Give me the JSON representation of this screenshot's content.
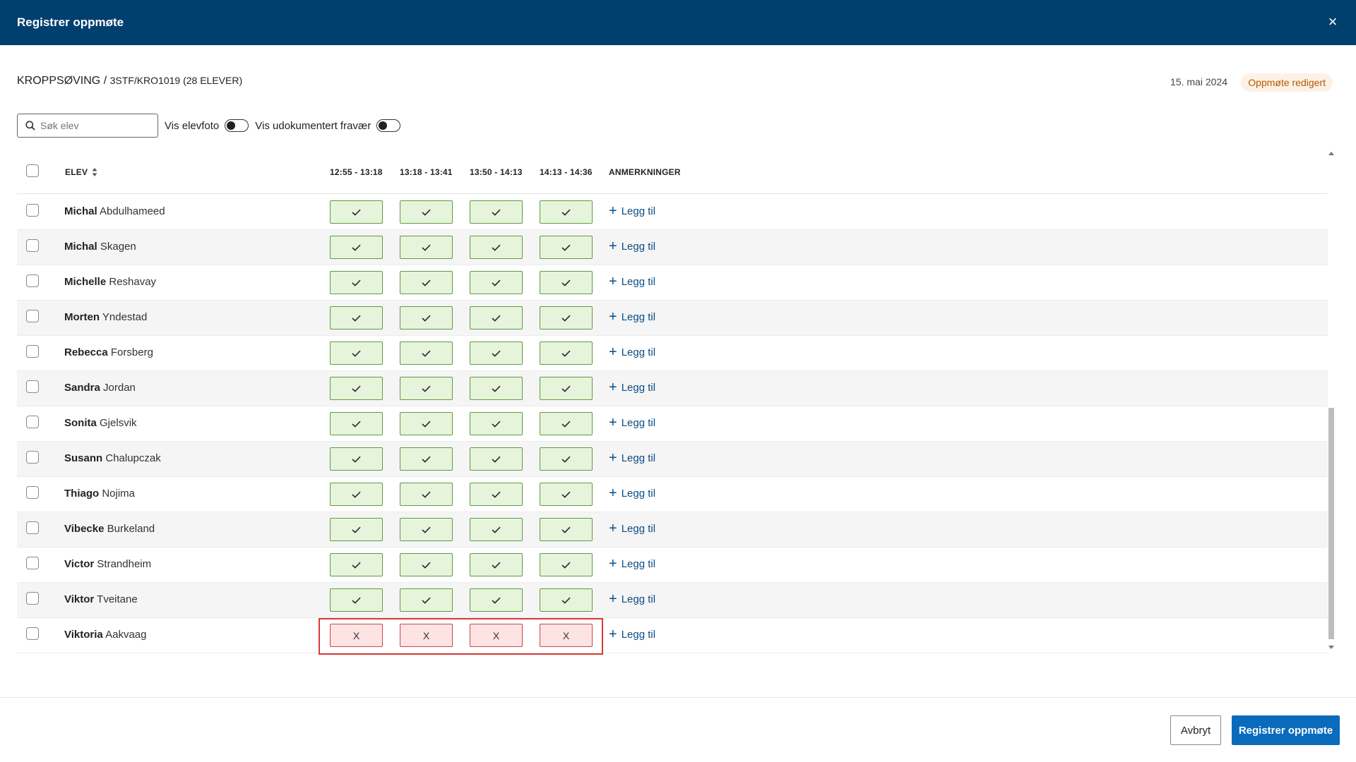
{
  "header": {
    "title": "Registrer oppmøte",
    "close_icon": "×"
  },
  "course": {
    "name": "KROPPSØVING",
    "separator": " / ",
    "group": "3STF/KRO1019 (28 ELEVER)"
  },
  "date": "15. mai 2024",
  "status_badge": "Oppmøte redigert",
  "search": {
    "placeholder": "Søk elev",
    "value": ""
  },
  "toggles": {
    "photo_label": "Vis elevfoto",
    "photo_on": false,
    "undocumented_label": "Vis udokumentert fravær",
    "undocumented_on": false
  },
  "table": {
    "col_student": "ELEV",
    "periods": [
      "12:55 - 13:18",
      "13:18 - 13:41",
      "13:50 - 14:13",
      "14:13 - 14:36"
    ],
    "col_remarks": "ANMERKNINGER",
    "remark_action": "Legg til",
    "absent_mark": "X",
    "rows": [
      {
        "first": "Michal",
        "last": "Abdulhameed",
        "status": "present"
      },
      {
        "first": "Michal",
        "last": "Skagen",
        "status": "present"
      },
      {
        "first": "Michelle",
        "last": "Reshavay",
        "status": "present"
      },
      {
        "first": "Morten",
        "last": "Yndestad",
        "status": "present"
      },
      {
        "first": "Rebecca",
        "last": "Forsberg",
        "status": "present"
      },
      {
        "first": "Sandra",
        "last": "Jordan",
        "status": "present"
      },
      {
        "first": "Sonita",
        "last": "Gjelsvik",
        "status": "present"
      },
      {
        "first": "Susann",
        "last": "Chalupczak",
        "status": "present"
      },
      {
        "first": "Thiago",
        "last": "Nojima",
        "status": "present"
      },
      {
        "first": "Vibecke",
        "last": "Burkeland",
        "status": "present"
      },
      {
        "first": "Victor",
        "last": "Strandheim",
        "status": "present"
      },
      {
        "first": "Viktor",
        "last": "Tveitane",
        "status": "present"
      },
      {
        "first": "Viktoria",
        "last": "Aakvaag",
        "status": "absent"
      }
    ]
  },
  "footer": {
    "cancel_label": "Avbryt",
    "submit_label": "Registrer oppmøte"
  },
  "colors": {
    "header": "#003f6e",
    "present_bg": "#e7f4dc",
    "present_border": "#5f9b3e",
    "absent_bg": "#fde3e3",
    "absent_border": "#c94646",
    "primary": "#0a6bbd",
    "highlight": "#d63a3a"
  }
}
